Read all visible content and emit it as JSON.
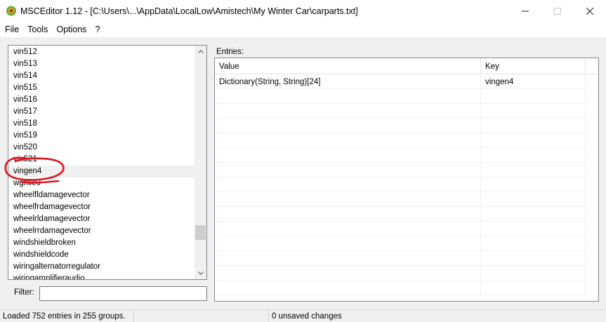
{
  "window": {
    "title": "MSCEditor 1.12 - [C:\\Users\\...\\AppData\\LocalLow\\Amistech\\My Winter Car\\carparts.txt]",
    "icon": "msceditor-app-icon"
  },
  "menu": {
    "items": [
      "File",
      "Tools",
      "Options",
      "?"
    ]
  },
  "variables": {
    "items": [
      "vin512",
      "vin513",
      "vin514",
      "vin515",
      "vin516",
      "vin517",
      "vin518",
      "vin519",
      "vin520",
      "vin521",
      "vingen4",
      "wgrille0",
      "wheelfldamagevector",
      "wheelfrdamagevector",
      "wheelrldamagevector",
      "wheelrrdamagevector",
      "windshieldbroken",
      "windshieldcode",
      "wiringalternatorregulator",
      "wiringamplifieraudio"
    ],
    "selected": "vingen4",
    "annotation_color": "#e0141e"
  },
  "filter": {
    "label": "Filter:",
    "value": ""
  },
  "entries": {
    "label": "Entries:",
    "columns": [
      "Value",
      "Key"
    ],
    "rows": [
      {
        "value": "Dictionary(String, String)[24]",
        "key": "vingen4"
      }
    ]
  },
  "status": {
    "loaded": "Loaded 752 entries in 255 groups.",
    "middle": "",
    "unsaved": "0 unsaved changes"
  }
}
